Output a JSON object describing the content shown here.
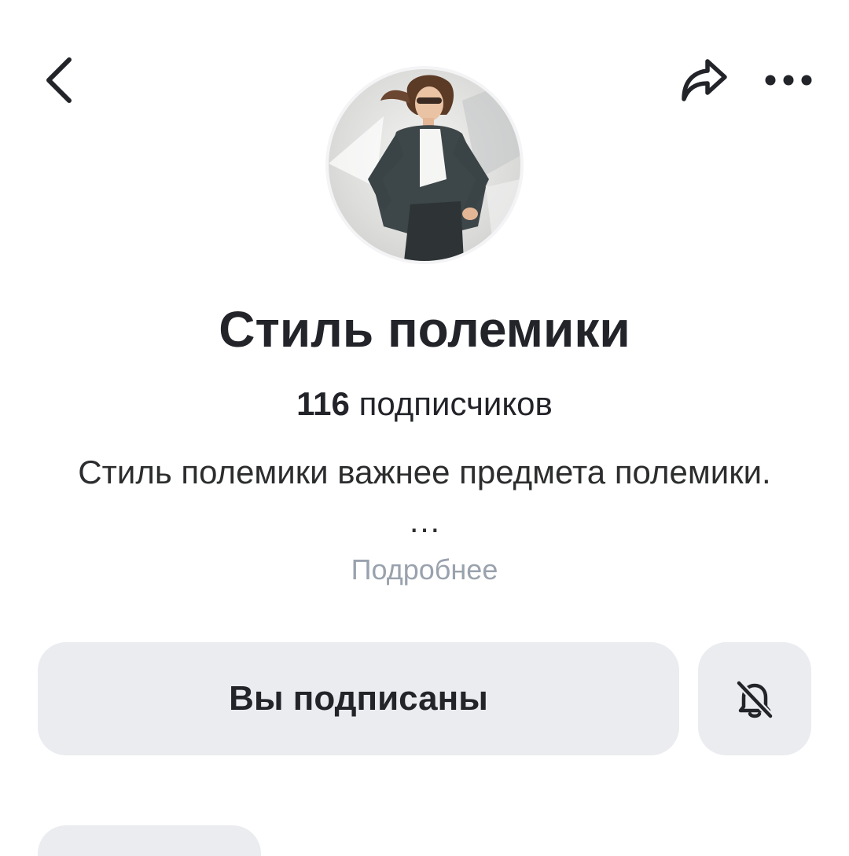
{
  "header": {
    "back_icon": "chevron-left-icon",
    "share_icon": "share-arrow-icon",
    "more_icon": "more-horizontal-icon"
  },
  "profile": {
    "title": "Стиль полемики",
    "subscribers_count": "116",
    "subscribers_label": "подписчиков",
    "description": "Стиль полемики важнее предмета полемики. …",
    "more_link": "Подробнее"
  },
  "actions": {
    "subscribed_label": "Вы подписаны",
    "notifications_icon": "bell-off-icon"
  },
  "colors": {
    "text": "#222429",
    "secondary": "#99a2ad",
    "button_bg": "#ebecf0"
  }
}
